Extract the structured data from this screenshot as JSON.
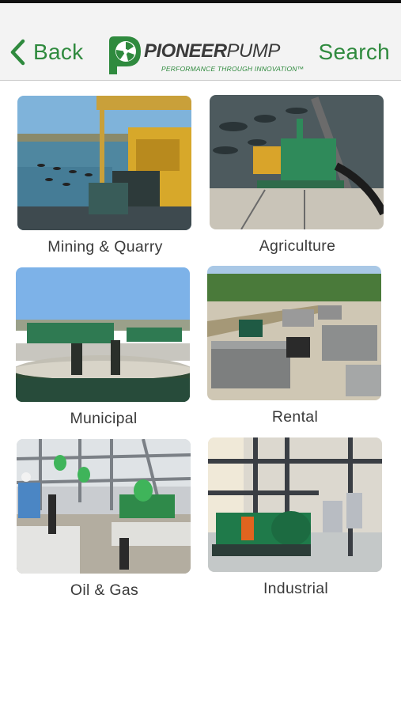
{
  "navbar": {
    "back_label": "Back",
    "search_label": "Search",
    "logo_word_bold": "PIONEER",
    "logo_word_light": "PUMP",
    "logo_tagline": "PERFORMANCE THROUGH INNOVATION™"
  },
  "categories": [
    {
      "label": "Mining & Quarry"
    },
    {
      "label": "Agriculture"
    },
    {
      "label": "Municipal"
    },
    {
      "label": "Rental"
    },
    {
      "label": "Oil & Gas"
    },
    {
      "label": "Industrial"
    }
  ],
  "colors": {
    "brand_green": "#2f8a3e",
    "navbar_bg": "#f3f3f3",
    "caption_text": "#3a3a3a"
  }
}
